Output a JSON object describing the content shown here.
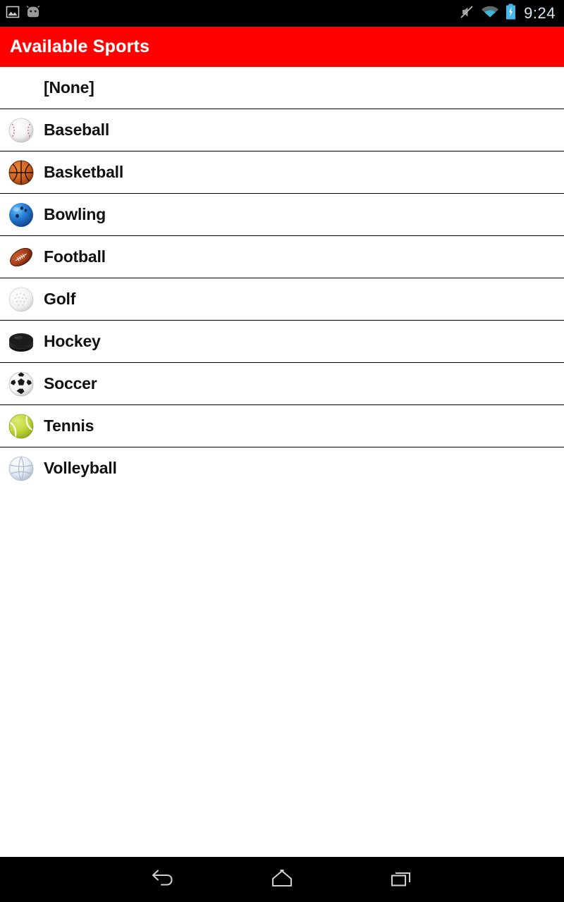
{
  "status_bar": {
    "time": "9:24",
    "left_icons": [
      {
        "name": "screenshot-icon",
        "glyph": "image"
      },
      {
        "name": "android-head-icon",
        "glyph": "android"
      }
    ],
    "right_icons": [
      {
        "name": "silent-mode-icon",
        "glyph": "mute"
      },
      {
        "name": "wifi-icon",
        "glyph": "wifi"
      },
      {
        "name": "battery-charging-icon",
        "glyph": "battery"
      }
    ],
    "background_color": "#000000",
    "text_color": "#d8e6ee"
  },
  "action_bar": {
    "title": "Available Sports",
    "background_color": "#ff0000",
    "title_color": "#ffffff"
  },
  "list": {
    "items": [
      {
        "label": "[None]",
        "icon": "none",
        "has_icon": false
      },
      {
        "label": "Baseball",
        "icon": "baseball-icon",
        "has_icon": true
      },
      {
        "label": "Basketball",
        "icon": "basketball-icon",
        "has_icon": true
      },
      {
        "label": "Bowling",
        "icon": "bowling-ball-icon",
        "has_icon": true
      },
      {
        "label": "Football",
        "icon": "football-icon",
        "has_icon": true
      },
      {
        "label": "Golf",
        "icon": "golf-ball-icon",
        "has_icon": true
      },
      {
        "label": "Hockey",
        "icon": "hockey-puck-icon",
        "has_icon": true
      },
      {
        "label": "Soccer",
        "icon": "soccer-ball-icon",
        "has_icon": true
      },
      {
        "label": "Tennis",
        "icon": "tennis-ball-icon",
        "has_icon": true
      },
      {
        "label": "Volleyball",
        "icon": "volleyball-icon",
        "has_icon": true
      }
    ],
    "divider_color": "#000000",
    "label_color": "#111111",
    "background_color": "#ffffff"
  },
  "nav_bar": {
    "buttons": [
      {
        "name": "back-button",
        "glyph": "back"
      },
      {
        "name": "home-button",
        "glyph": "home"
      },
      {
        "name": "recents-button",
        "glyph": "recents"
      }
    ],
    "background_color": "#000000",
    "icon_color": "#cfcfcf"
  }
}
